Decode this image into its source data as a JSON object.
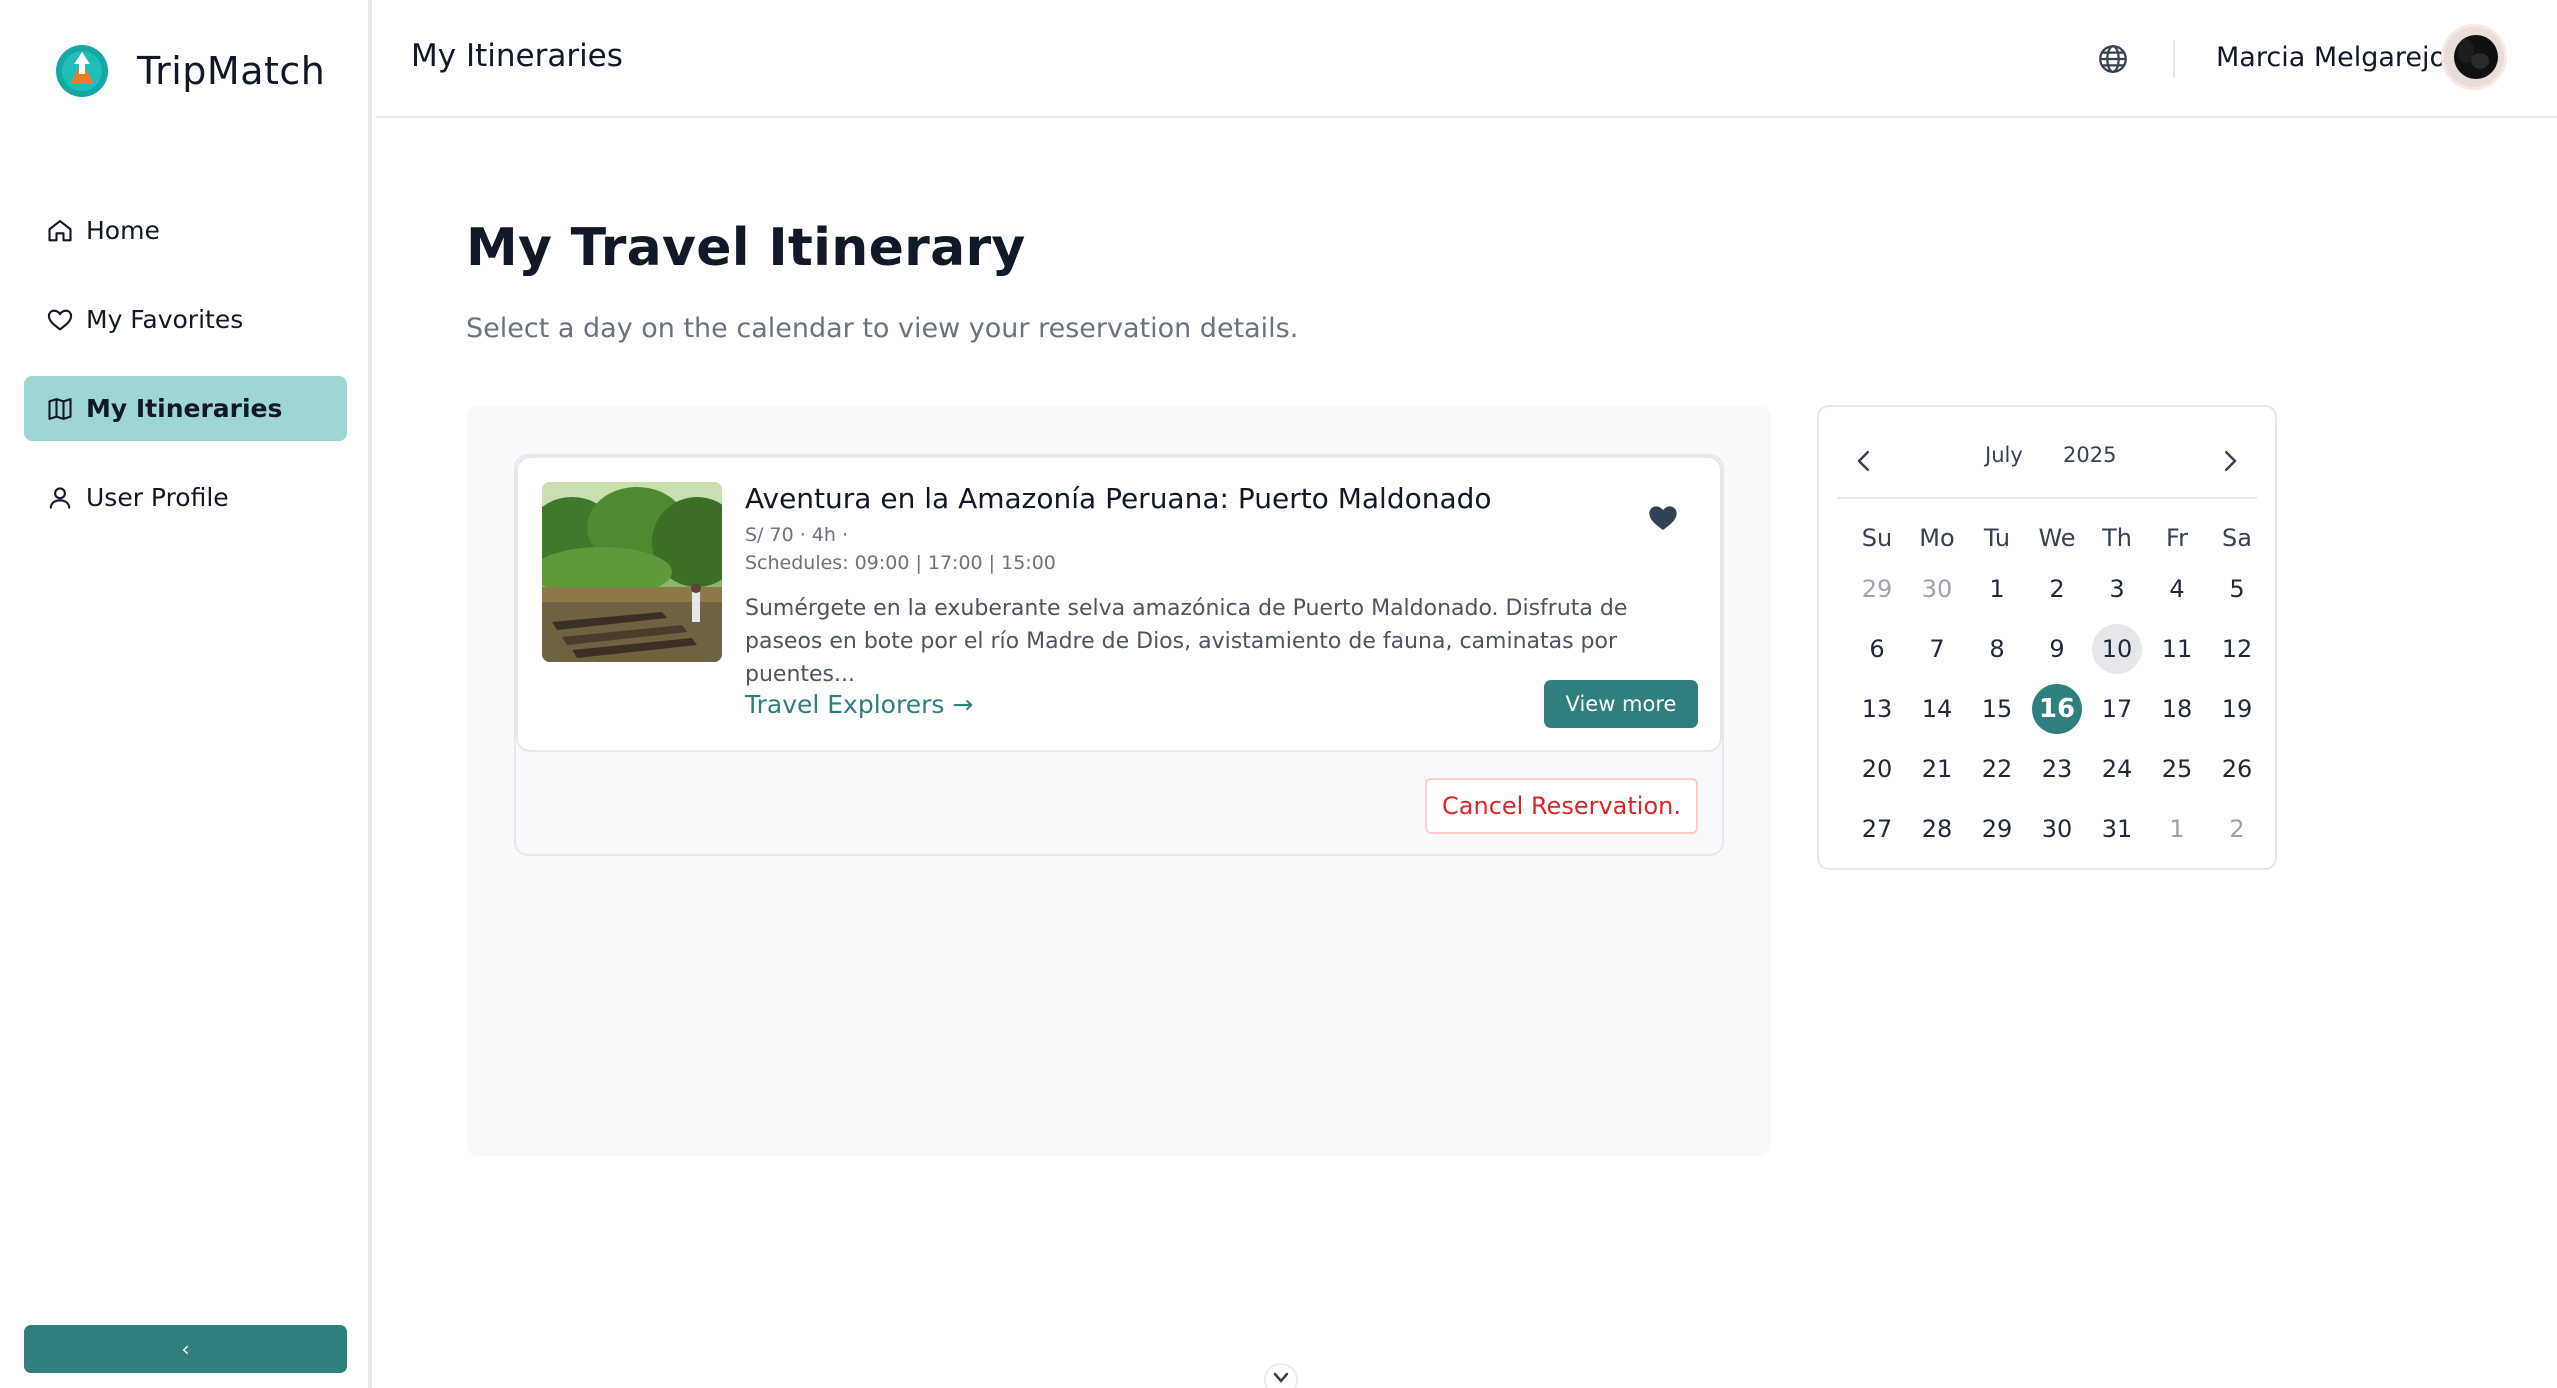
{
  "app": {
    "name": "TripMatch"
  },
  "sidebar": {
    "items": [
      {
        "label": "Home",
        "icon": "home-icon"
      },
      {
        "label": "My Favorites",
        "icon": "heart-icon"
      },
      {
        "label": "My Itineraries",
        "icon": "map-icon",
        "active": true
      },
      {
        "label": "User Profile",
        "icon": "user-icon"
      }
    ],
    "collapse_label": "‹"
  },
  "header": {
    "title": "My Itineraries",
    "user_name": "Marcia Melgarejo"
  },
  "main": {
    "title": "My Travel Itinerary",
    "subtitle": "Select a day on the calendar to view your reservation details."
  },
  "reservation": {
    "title": "Aventura en la Amazonía Peruana: Puerto Maldonado",
    "meta": "S/ 70 · 4h ·",
    "schedules": "Schedules: 09:00 | 17:00 | 15:00",
    "description": "Sumérgete en la exuberante selva amazónica de Puerto Maldonado. Disfruta de paseos en bote por el río Madre de Dios, avistamiento de fauna, caminatas por puentes...",
    "agency": "Travel Explorers →",
    "view_more": "View more",
    "cancel": "Cancel Reservation.",
    "favorited": true
  },
  "calendar": {
    "month": "July",
    "year": "2025",
    "weekdays": [
      "Su",
      "Mo",
      "Tu",
      "We",
      "Th",
      "Fr",
      "Sa"
    ],
    "days": [
      {
        "d": "29",
        "muted": true
      },
      {
        "d": "30",
        "muted": true
      },
      {
        "d": "1"
      },
      {
        "d": "2"
      },
      {
        "d": "3"
      },
      {
        "d": "4"
      },
      {
        "d": "5"
      },
      {
        "d": "6"
      },
      {
        "d": "7"
      },
      {
        "d": "8"
      },
      {
        "d": "9"
      },
      {
        "d": "10",
        "today": true
      },
      {
        "d": "11"
      },
      {
        "d": "12"
      },
      {
        "d": "13"
      },
      {
        "d": "14"
      },
      {
        "d": "15"
      },
      {
        "d": "16",
        "selected": true
      },
      {
        "d": "17"
      },
      {
        "d": "18"
      },
      {
        "d": "19"
      },
      {
        "d": "20"
      },
      {
        "d": "21"
      },
      {
        "d": "22"
      },
      {
        "d": "23"
      },
      {
        "d": "24"
      },
      {
        "d": "25"
      },
      {
        "d": "26"
      },
      {
        "d": "27"
      },
      {
        "d": "28"
      },
      {
        "d": "29"
      },
      {
        "d": "30"
      },
      {
        "d": "31"
      },
      {
        "d": "1",
        "muted": true
      },
      {
        "d": "2",
        "muted": true
      }
    ]
  },
  "colors": {
    "accent": "#2f7f7c",
    "active_nav": "#9ed6d3",
    "danger": "#dc2626"
  }
}
